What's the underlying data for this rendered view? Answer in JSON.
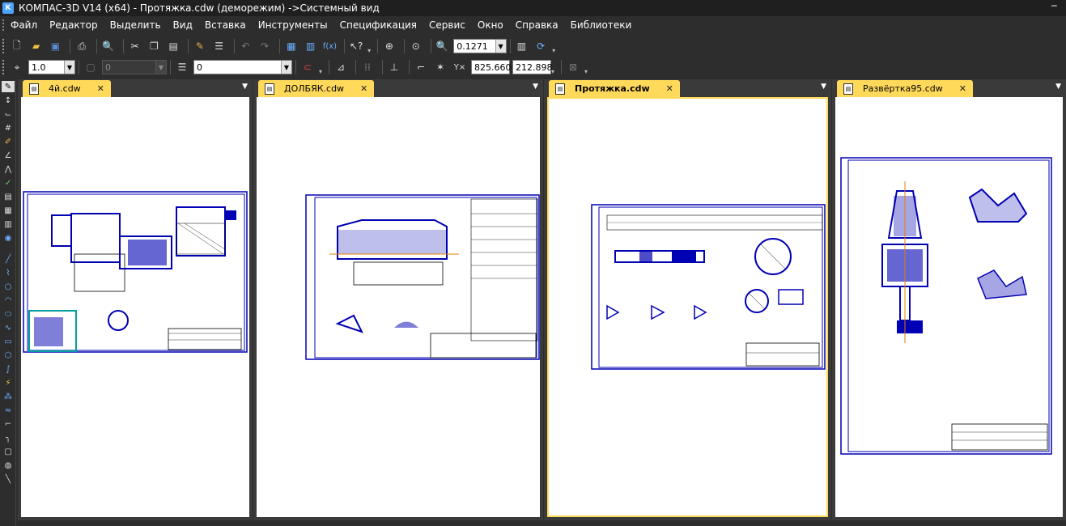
{
  "window": {
    "title": "КОМПАС-3D V14 (x64) - Протяжка.cdw (деморежим) ->Системный вид",
    "app_icon_letter": "K"
  },
  "menu": [
    "Файл",
    "Редактор",
    "Выделить",
    "Вид",
    "Вставка",
    "Инструменты",
    "Спецификация",
    "Сервис",
    "Окно",
    "Справка",
    "Библиотеки"
  ],
  "toolbar": {
    "zoom_value": "0.1271",
    "step_value": "1.0",
    "layer_value": "0",
    "style_value": "0",
    "coord_x": "825.660",
    "coord_y": "212.898"
  },
  "documents": [
    {
      "tab_label": "4й.cdw",
      "state": "inactive"
    },
    {
      "tab_label": "ДОЛБЯК.cdw",
      "state": "inactive"
    },
    {
      "tab_label": "Протяжка.cdw",
      "state": "active"
    },
    {
      "tab_label": "Развёртка95.cdw",
      "state": "inactive"
    }
  ],
  "colors": {
    "drawing_line": "#0000b4",
    "active_frame": "#ffd95a",
    "background": "#2d2d2d"
  }
}
